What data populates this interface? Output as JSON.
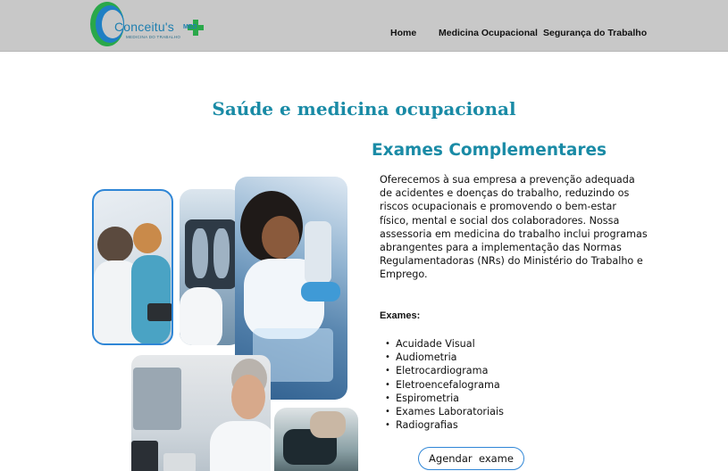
{
  "header": {
    "logo": {
      "name": "Conceitu's",
      "badge": "MED",
      "tagline": "MEDICINA DO TRABALHO"
    },
    "nav": [
      {
        "label": "Home"
      },
      {
        "label": "Medicina Ocupacional"
      },
      {
        "label": "Segurança do Trabalho"
      }
    ]
  },
  "main": {
    "title": "Saúde e medicina ocupacional",
    "section": {
      "heading": "Exames Complementares",
      "paragraph": "Oferecemos à sua empresa a prevenção adequada de acidentes e doenças do trabalho, reduzindo os riscos ocupacionais e promovendo o bem-estar físico, mental e social dos colaboradores. Nossa assessoria em medicina do trabalho inclui programas abrangentes para a implementação das Normas Regulamentadoras (NRs) do Ministério do Trabalho e Emprego.",
      "exams_label": "Exames:",
      "exams": [
        "Acuidade Visual",
        "Audiometria",
        "Eletrocardiograma",
        "Eletroencefalograma",
        "Espirometria",
        "Exames Laboratoriais",
        "Radiografias"
      ],
      "cta_label": "Agendar  exame"
    },
    "photos": [
      {
        "name": "spirometry-photo"
      },
      {
        "name": "xray-photo"
      },
      {
        "name": "lab-microscope-photo"
      },
      {
        "name": "doctor-computer-photo"
      },
      {
        "name": "blood-pressure-photo"
      }
    ]
  },
  "colors": {
    "header_bg": "#c8c8c8",
    "accent": "#1a8ba6",
    "button_border": "#2f86d6",
    "logo_green": "#2aa84a",
    "logo_blue": "#1f7fc4"
  }
}
